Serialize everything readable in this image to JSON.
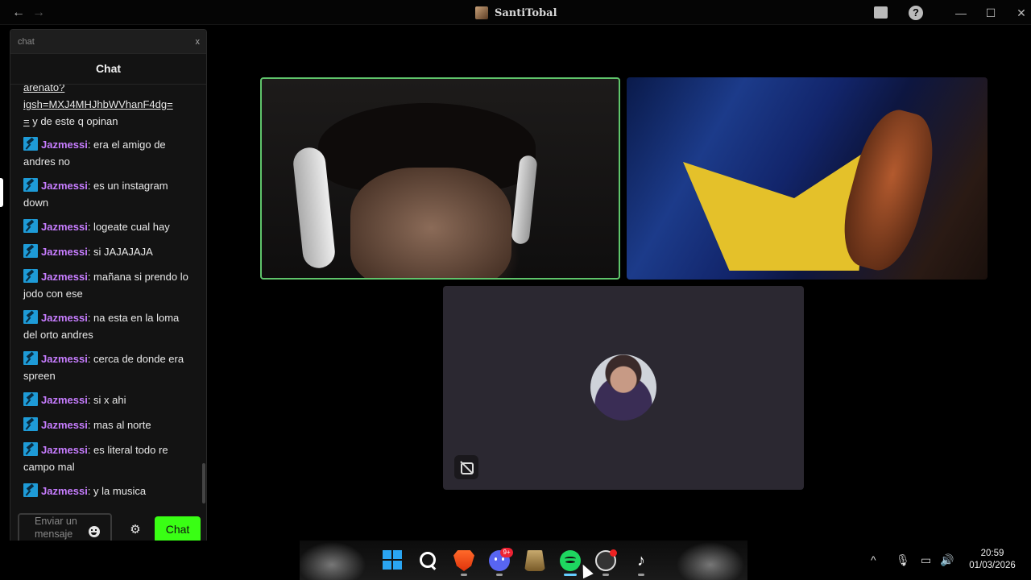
{
  "window": {
    "title": "SantiTobal",
    "back_icon": "arrow-left-icon",
    "forward_icon": "arrow-right-icon"
  },
  "chat": {
    "topbar_label": "chat",
    "close_label": "x",
    "header": "Chat",
    "partial_message": {
      "line1": "arenato?",
      "link": "igsh=MXJ4MHJhbWVhanF4dg=",
      "link_end": "=",
      "tail": " y de este q opinan"
    },
    "messages": [
      {
        "user": "Jazmessi",
        "text": ": era el amigo de andres no"
      },
      {
        "user": "Jazmessi",
        "text": ": es un instagram down"
      },
      {
        "user": "Jazmessi",
        "text": ": logeate cual hay"
      },
      {
        "user": "Jazmessi",
        "text": ": si JAJAJAJA"
      },
      {
        "user": "Jazmessi",
        "text": ": mañana si prendo lo jodo con ese"
      },
      {
        "user": "Jazmessi",
        "text": ": na esta en la loma del orto andres"
      },
      {
        "user": "Jazmessi",
        "text": ": cerca de donde era spreen"
      },
      {
        "user": "Jazmessi",
        "text": ": si x ahi"
      },
      {
        "user": "Jazmessi",
        "text": ": mas al norte"
      },
      {
        "user": "Jazmessi",
        "text": ": es literal todo re campo mal"
      },
      {
        "user": "Jazmessi",
        "text": ": y la musica"
      }
    ],
    "input_placeholder": "Enviar un mensaje",
    "send_label": "Chat",
    "username_color": "#c77dff",
    "send_color": "#39ff14"
  },
  "taskbar": {
    "discord_badge": "9+",
    "tiktok_glyph": "♪",
    "tray_chevron": "^",
    "time": "20:59",
    "date": "01/03/2026"
  }
}
